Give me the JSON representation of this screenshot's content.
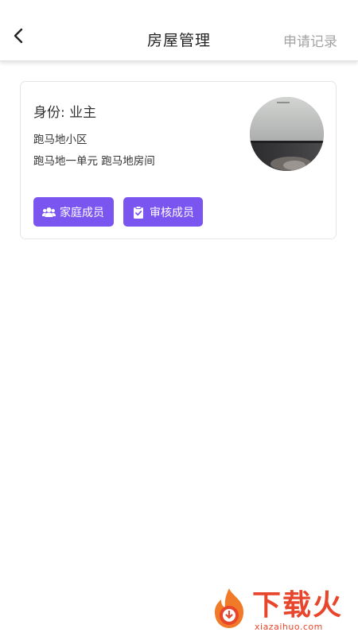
{
  "header": {
    "title": "房屋管理",
    "action_label": "申请记录",
    "back_icon": "chevron-left-icon"
  },
  "house_card": {
    "identity": "身份: 业主",
    "community": "跑马地小区",
    "unit_room": "跑马地一单元 跑马地房间",
    "buttons": {
      "family": {
        "label": "家庭成员",
        "icon": "users-icon"
      },
      "review": {
        "label": "审核成员",
        "icon": "clipboard-check-icon"
      }
    }
  },
  "watermark": {
    "text": "下载火",
    "url": "xiazaihuo.com"
  },
  "colors": {
    "accent": "#7b55f0",
    "title": "#222222",
    "muted": "#a3a3a3",
    "watermark": "#e8462c"
  }
}
